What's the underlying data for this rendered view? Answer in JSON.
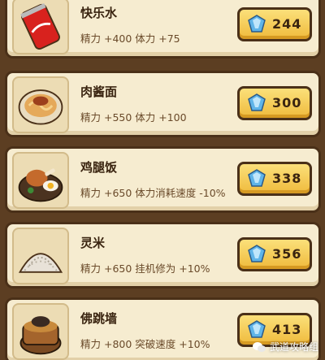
{
  "items": [
    {
      "name": "快乐水",
      "effect": "精力 +400 体力 +75",
      "price": "244",
      "icon": "cola-can-icon"
    },
    {
      "name": "肉酱面",
      "effect": "精力 +550 体力 +100",
      "price": "300",
      "icon": "meat-sauce-noodles-icon"
    },
    {
      "name": "鸡腿饭",
      "effect": "精力 +650 体力消耗速度 -10%",
      "price": "338",
      "icon": "chicken-leg-rice-icon"
    },
    {
      "name": "灵米",
      "effect": "精力 +650 挂机修为 +10%",
      "price": "356",
      "icon": "spirit-rice-icon"
    },
    {
      "name": "佛跳墙",
      "effect": "精力 +800 突破速度 +10%",
      "price": "413",
      "icon": "buddha-jumps-wall-icon"
    }
  ],
  "currency_icon": "blue-crystal-icon",
  "watermark": {
    "text": "武道攻略组",
    "icon": "wechat-icon"
  },
  "colors": {
    "card_bg": "#f6ecd0",
    "border": "#4a3018",
    "button": "#f3c94c",
    "crystal": "#5fb4e8"
  }
}
